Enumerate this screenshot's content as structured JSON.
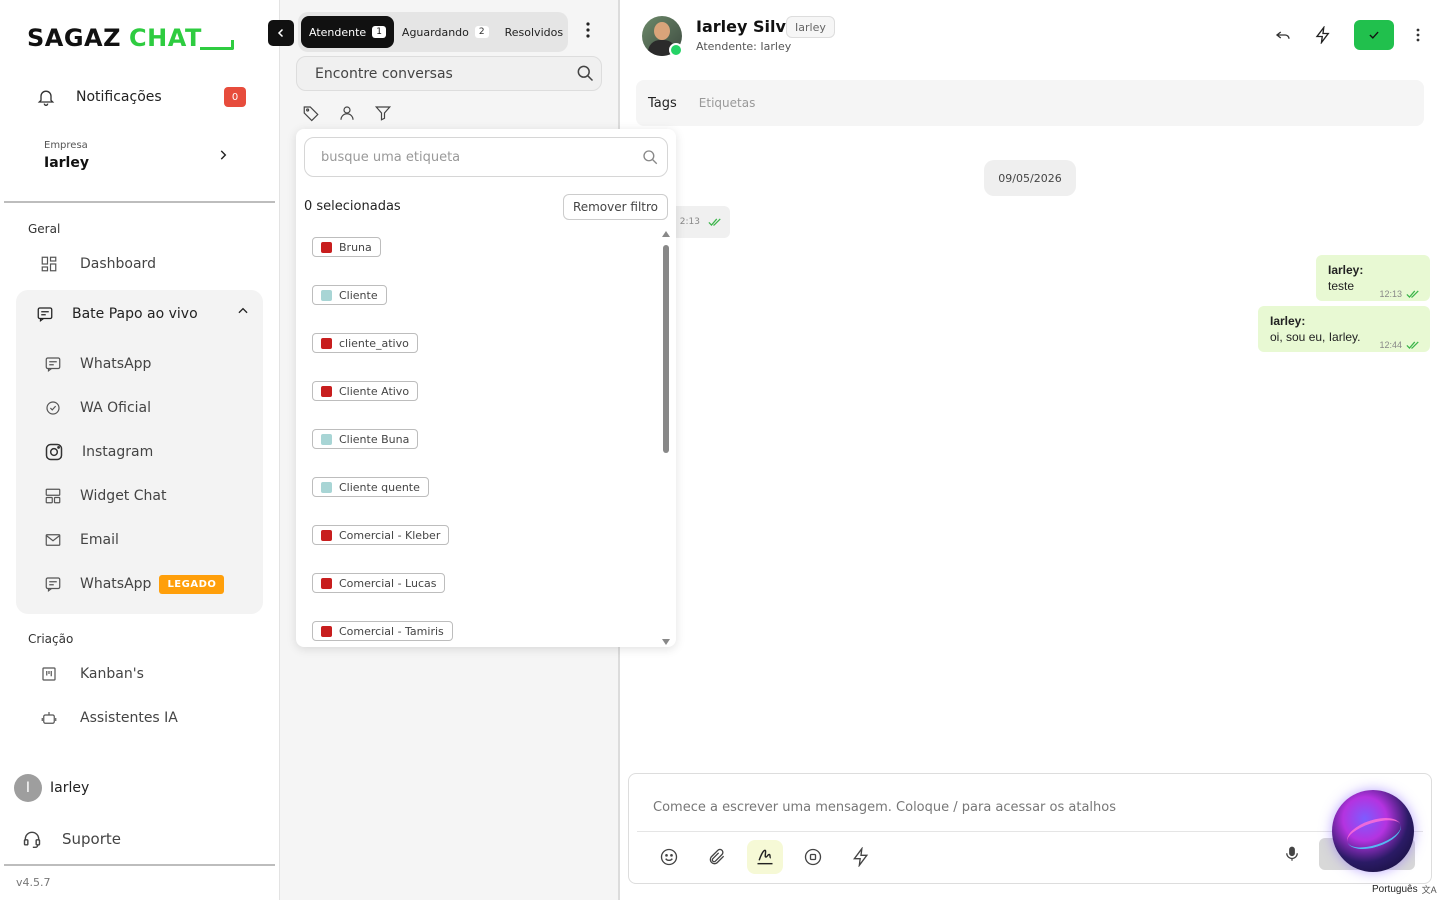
{
  "sidebar": {
    "logo_left": "SAGAZ",
    "logo_right": "CHAT",
    "notifications": {
      "label": "Notificações",
      "count": "0"
    },
    "company": {
      "caption": "Empresa",
      "name": "Iarley"
    },
    "section_geral": "Geral",
    "dashboard": "Dashboard",
    "live_chat": {
      "label": "Bate Papo ao vivo",
      "items": [
        {
          "label": "WhatsApp",
          "icon": "chat-icon"
        },
        {
          "label": "WA Oficial",
          "icon": "check-circle-icon"
        },
        {
          "label": "Instagram",
          "icon": "instagram-icon"
        },
        {
          "label": "Widget Chat",
          "icon": "widget-icon"
        },
        {
          "label": "Email",
          "icon": "mail-icon"
        },
        {
          "label": "WhatsApp",
          "icon": "chat-icon",
          "badge": "LEGADO"
        }
      ]
    },
    "section_criacao": "Criação",
    "kanban": "Kanban's",
    "assistants": "Assistentes IA",
    "user": {
      "initial": "I",
      "name": "Iarley"
    },
    "support": "Suporte",
    "version": "v4.5.7"
  },
  "list": {
    "tabs": [
      {
        "label": "Atendente",
        "count": "1",
        "active": true
      },
      {
        "label": "Aguardando",
        "count": "2",
        "active": false
      },
      {
        "label": "Resolvidos",
        "count": "",
        "active": false
      }
    ],
    "search_placeholder": "Encontre conversas"
  },
  "tag_dropdown": {
    "search_placeholder": "busque uma etiqueta",
    "selected_text": "0 selecionadas",
    "remove_filter": "Remover filtro",
    "tags": [
      {
        "name": "Bruna",
        "color": "#c81e1e"
      },
      {
        "name": "Cliente",
        "color": "#a8d5d5"
      },
      {
        "name": "cliente_ativo",
        "color": "#c81e1e"
      },
      {
        "name": "Cliente Ativo",
        "color": "#c81e1e"
      },
      {
        "name": "Cliente Buna",
        "color": "#a8d5d5"
      },
      {
        "name": "Cliente quente",
        "color": "#a8d5d5"
      },
      {
        "name": "Comercial - Kleber",
        "color": "#c81e1e"
      },
      {
        "name": "Comercial - Lucas",
        "color": "#c81e1e"
      },
      {
        "name": "Comercial - Tamiris",
        "color": "#c81e1e"
      }
    ]
  },
  "chat": {
    "contact_name": "Iarley Silva",
    "contact_tag": "Iarley",
    "agent_line": "Atendente: Iarley",
    "tags_label": "Tags",
    "tags_placeholder": "Etiquetas",
    "date": "09/05/2026",
    "partial_time": "2:13",
    "messages": [
      {
        "author": "Iarley:",
        "text": "teste",
        "time": "12:13"
      },
      {
        "author": "Iarley:",
        "text": "oi, sou eu, Iarley.",
        "time": "12:44"
      }
    ],
    "composer_placeholder": "Comece a escrever uma mensagem. Coloque / para acessar os atalhos",
    "language": "Português"
  },
  "colors": {
    "accent_green": "#21c04d",
    "badge_red": "#e74c3c",
    "legado_orange": "#ff9f0a"
  }
}
